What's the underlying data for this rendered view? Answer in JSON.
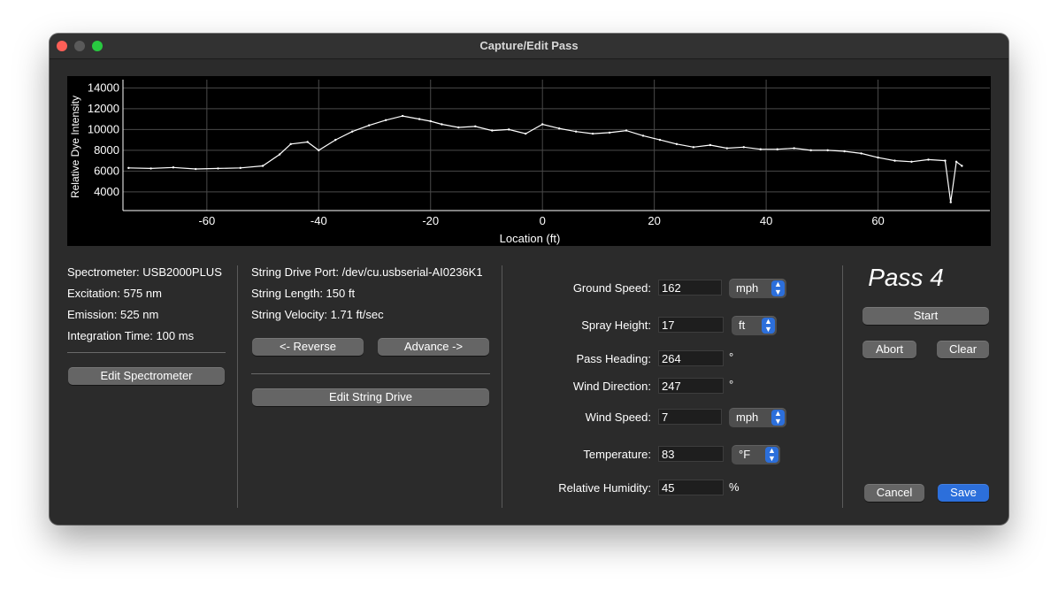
{
  "window": {
    "title": "Capture/Edit Pass"
  },
  "chart_data": {
    "type": "line",
    "xlabel": "Location (ft)",
    "ylabel": "Relative Dye Intensity",
    "xlim": [
      -75,
      80
    ],
    "ylim": [
      2200,
      14800
    ],
    "xticks": [
      -60,
      -40,
      -20,
      0,
      20,
      40,
      60
    ],
    "yticks": [
      4000,
      6000,
      8000,
      10000,
      12000,
      14000
    ],
    "grid": true,
    "series": [
      {
        "x": [
          -74,
          -70,
          -66,
          -62,
          -58,
          -54,
          -50,
          -47,
          -45,
          -42,
          -40,
          -37,
          -34,
          -31,
          -28,
          -25,
          -22,
          -20,
          -18,
          -15,
          -12,
          -9,
          -6,
          -3,
          0,
          3,
          6,
          9,
          12,
          15,
          18,
          21,
          24,
          27,
          30,
          33,
          36,
          39,
          42,
          45,
          48,
          51,
          54,
          57,
          60,
          63,
          66,
          69,
          72,
          73,
          74,
          75
        ],
        "y": [
          6300,
          6250,
          6350,
          6200,
          6250,
          6300,
          6500,
          7600,
          8600,
          8800,
          8000,
          9000,
          9800,
          10400,
          10900,
          11300,
          11000,
          10800,
          10500,
          10200,
          10300,
          9900,
          10000,
          9600,
          10500,
          10100,
          9800,
          9600,
          9700,
          9900,
          9400,
          9000,
          8600,
          8300,
          8500,
          8200,
          8300,
          8100,
          8100,
          8200,
          8000,
          8000,
          7900,
          7700,
          7300,
          7000,
          6900,
          7100,
          7000,
          3000,
          6900,
          6500
        ]
      }
    ]
  },
  "spectrometer": {
    "name": "Spectrometer: USB2000PLUS",
    "excitation": "Excitation: 575 nm",
    "emission": "Emission: 525 nm",
    "integration": "Integration Time: 100 ms",
    "edit_label": "Edit Spectrometer"
  },
  "string_drive": {
    "port": "String Drive Port: /dev/cu.usbserial-AI0236K1",
    "length": "String Length: 150 ft",
    "velocity": "String Velocity: 1.71 ft/sec",
    "reverse_label": "<- Reverse",
    "advance_label": "Advance ->",
    "edit_label": "Edit String Drive"
  },
  "conditions": {
    "ground_speed": {
      "label": "Ground Speed:",
      "value": "162",
      "unit": "mph"
    },
    "spray_height": {
      "label": "Spray Height:",
      "value": "17",
      "unit": "ft"
    },
    "pass_heading": {
      "label": "Pass Heading:",
      "value": "264",
      "unit": "°"
    },
    "wind_direction": {
      "label": "Wind Direction:",
      "value": "247",
      "unit": "°"
    },
    "wind_speed": {
      "label": "Wind Speed:",
      "value": "7",
      "unit": "mph"
    },
    "temperature": {
      "label": "Temperature:",
      "value": "83",
      "unit": "°F"
    },
    "humidity": {
      "label": "Relative Humidity:",
      "value": "45",
      "unit": "%"
    }
  },
  "pass": {
    "title": "Pass 4",
    "start_label": "Start",
    "abort_label": "Abort",
    "clear_label": "Clear",
    "cancel_label": "Cancel",
    "save_label": "Save"
  }
}
